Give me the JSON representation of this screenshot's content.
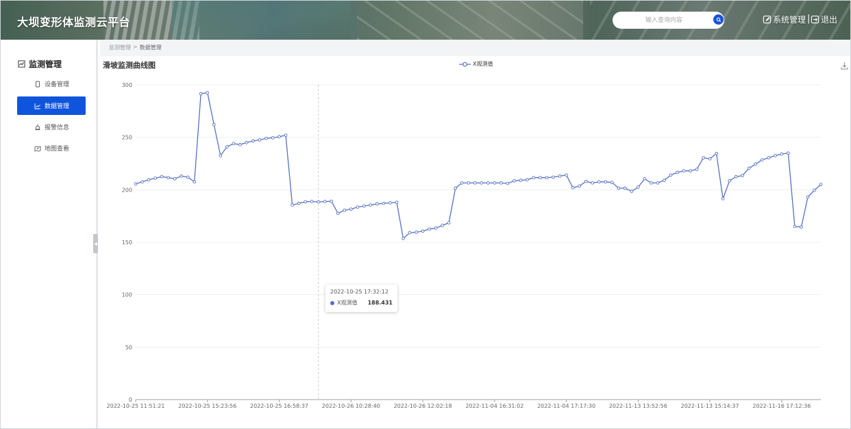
{
  "header": {
    "app_title": "大坝变形体监测云平台",
    "search_placeholder": "输入查询内容",
    "sys_manage_label": "系统管理",
    "divider": "|",
    "logout_label": "退出"
  },
  "sidebar": {
    "heading": "监测管理",
    "items": [
      {
        "label": "设备管理",
        "icon": "tablet-icon",
        "active": false
      },
      {
        "label": "数据管理",
        "icon": "line-chart-icon",
        "active": true
      },
      {
        "label": "报警信息",
        "icon": "alarm-icon",
        "active": false
      },
      {
        "label": "地图查看",
        "icon": "map-icon",
        "active": false
      }
    ]
  },
  "breadcrumb": {
    "parent": "监测管理",
    "separator": ">",
    "current": "数据管理"
  },
  "chart": {
    "title": "滑坡监测曲线图"
  },
  "tooltip": {
    "time": "2022-10-25 17:32:12",
    "series": "X观测值",
    "value": "188.431"
  },
  "colors": {
    "series_line": "#5470c6",
    "active_nav": "#0f55dc",
    "search_button": "#1653d8"
  },
  "chart_data": {
    "type": "line",
    "title": "滑坡监测曲线图",
    "xlabel": "",
    "ylabel": "",
    "ylim": [
      0,
      300
    ],
    "yticks": [
      0,
      50,
      100,
      150,
      200,
      250,
      300
    ],
    "grid": true,
    "legend_position": "top-center",
    "x_tick_labels": [
      "2022-10-25 11:51:21",
      "2022-10-25 15:23:56",
      "2022-10-25 16:58:37",
      "2022-10-26 10:28:40",
      "2022-10-26 12:02:18",
      "2022-11-04 16:31:02",
      "2022-11-04 17:17:30",
      "2022-11-13 13:52:56",
      "2022-11-13 15:14:37",
      "2022-11-16 17:12:36"
    ],
    "highlight_index": 28,
    "series": [
      {
        "name": "X观测值",
        "values": [
          205.5,
          207.5,
          209.5,
          211,
          212.5,
          211.5,
          210.5,
          213,
          212,
          207.5,
          291.5,
          292.5,
          262,
          232.5,
          241,
          244,
          243,
          245,
          246.5,
          247.5,
          249,
          249.5,
          250.5,
          252,
          185.5,
          187,
          188.5,
          188.8,
          188.431,
          188.8,
          189,
          177.5,
          180.5,
          181.5,
          183.5,
          184.5,
          185.5,
          186.5,
          187,
          187.5,
          188,
          153.5,
          159,
          159.5,
          160.5,
          162.5,
          163.5,
          166,
          168.5,
          201.5,
          206.5,
          206.5,
          206.5,
          206.5,
          206.5,
          206.5,
          206.5,
          206,
          208.5,
          209,
          209.5,
          211.5,
          211.5,
          211.5,
          212,
          213,
          214,
          202,
          203.5,
          208,
          206.5,
          207.5,
          207.5,
          207,
          201.5,
          201.5,
          198.5,
          202.5,
          210.5,
          206.5,
          206.5,
          209,
          214,
          216.5,
          218,
          218,
          219.5,
          230.5,
          229.5,
          234.5,
          191.5,
          208.5,
          212.5,
          213.5,
          220.5,
          224.5,
          228.5,
          230.5,
          232.5,
          234,
          235,
          165,
          164.5,
          193,
          199.5,
          205
        ]
      }
    ]
  }
}
